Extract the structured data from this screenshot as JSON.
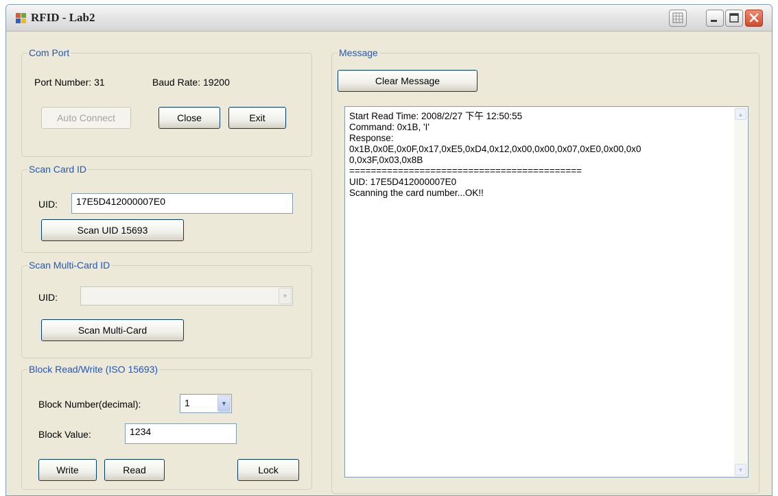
{
  "window": {
    "title": "RFID - Lab2"
  },
  "com_port": {
    "title": "Com Port",
    "port_number": "Port Number: 31",
    "baud_rate": "Baud Rate: 19200",
    "auto_connect": "Auto Connect",
    "close": "Close",
    "exit": "Exit"
  },
  "scan_card": {
    "title": "Scan Card ID",
    "uid_label": "UID:",
    "uid_value": "17E5D412000007E0",
    "scan_button": "Scan UID 15693"
  },
  "scan_multi": {
    "title": "Scan Multi-Card ID",
    "uid_label": "UID:",
    "scan_button": "Scan Multi-Card"
  },
  "block_rw": {
    "title": "Block Read/Write (ISO 15693)",
    "block_number_label": "Block Number(decimal):",
    "block_number_value": "1",
    "block_value_label": "Block Value:",
    "block_value": "1234",
    "write": "Write",
    "read": "Read",
    "lock": "Lock"
  },
  "message": {
    "title": "Message",
    "clear_button": "Clear Message",
    "lines": [
      "Start Read Time: 2008/2/27 下午 12:50:55",
      "Command: 0x1B, 'I'",
      "Response:",
      "0x1B,0x0E,0x0F,0x17,0xE5,0xD4,0x12,0x00,0x00,0x07,0xE0,0x00,0x0",
      "0,0x3F,0x03,0x8B",
      "===========================================",
      "UID: 17E5D412000007E0",
      "Scanning the card number...OK!!"
    ]
  },
  "icons": {
    "app": "app-windows-icon",
    "grid": "grid-icon",
    "minimize": "minimize-icon",
    "maximize": "maximize-icon",
    "close": "close-icon"
  },
  "colors": {
    "group_title": "#1c57c7",
    "window_bg": "#ece9d8",
    "close_button": "#d34a2c"
  }
}
